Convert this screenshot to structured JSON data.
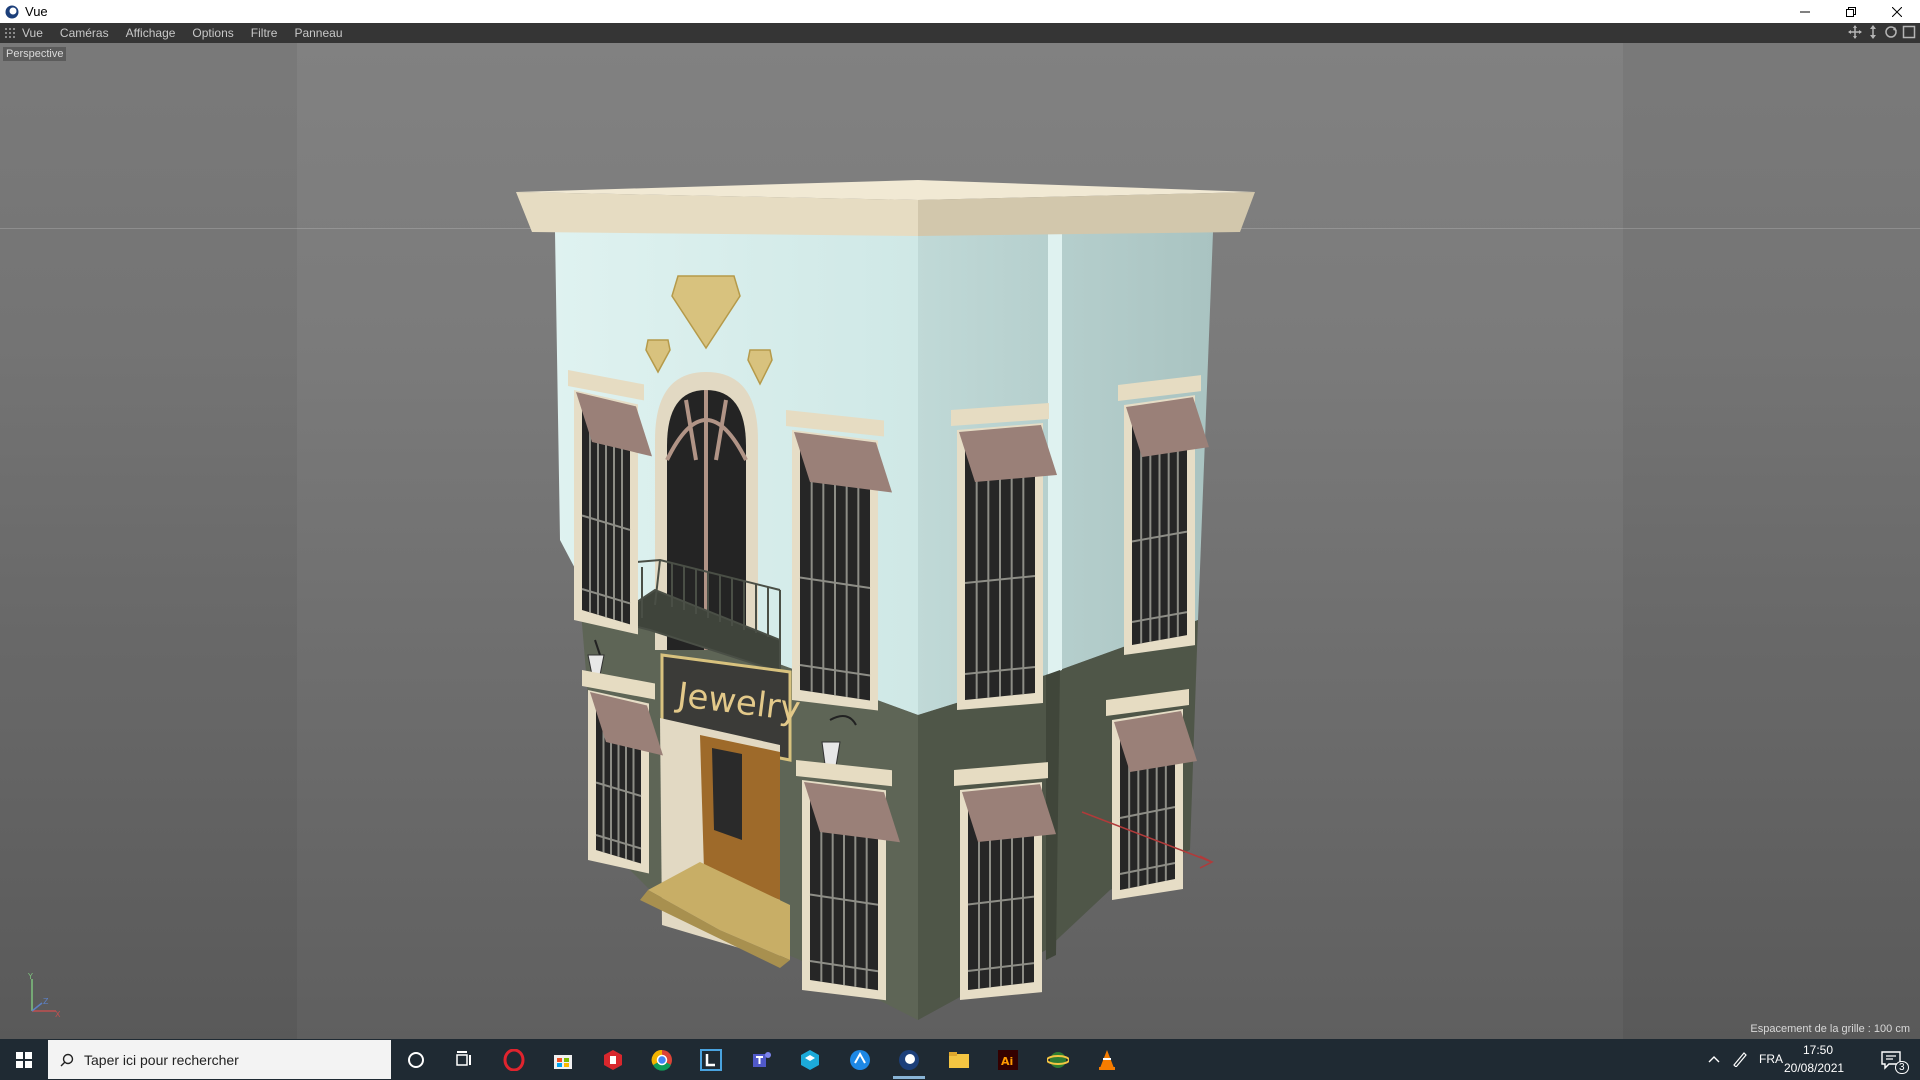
{
  "window": {
    "title": "Vue",
    "icons": {
      "app": "cinema4d-icon",
      "minimize": "minimize-icon",
      "restore": "restore-icon",
      "close": "close-icon"
    }
  },
  "menubar": {
    "items": [
      "Vue",
      "Caméras",
      "Affichage",
      "Options",
      "Filtre",
      "Panneau"
    ],
    "tools": [
      "move-view-icon",
      "zoom-view-icon",
      "rotate-view-icon",
      "maximize-view-icon"
    ]
  },
  "viewport": {
    "camera_label": "Perspective",
    "grid_spacing": "Espacement de la grille : 100 cm",
    "scene": {
      "sign_text": "Jewelry",
      "colors": {
        "wall_upper": "#cfe8e6",
        "wall_lower": "#5e6556",
        "cornice": "#e6dcc2",
        "window_frame": "#e6ddc6",
        "awning": "#9a8078",
        "gem": "#d8c27e"
      }
    },
    "axis": {
      "x": "X",
      "y": "Y",
      "z": "Z"
    }
  },
  "taskbar": {
    "search_placeholder": "Taper ici pour rechercher",
    "apps": [
      "cortana-icon",
      "task-view-icon",
      "opera-icon",
      "store-icon",
      "sketchup-icon",
      "chrome-icon",
      "lumion-icon",
      "teams-icon",
      "sketchfab-icon",
      "alt-browser-icon",
      "cinema4d-icon",
      "file-explorer-icon",
      "illustrator-icon",
      "earth-icon",
      "vlc-icon"
    ],
    "active_app": "cinema4d-icon",
    "language": "FRA",
    "time": "17:50",
    "date": "20/08/2021",
    "notifications": "3"
  }
}
